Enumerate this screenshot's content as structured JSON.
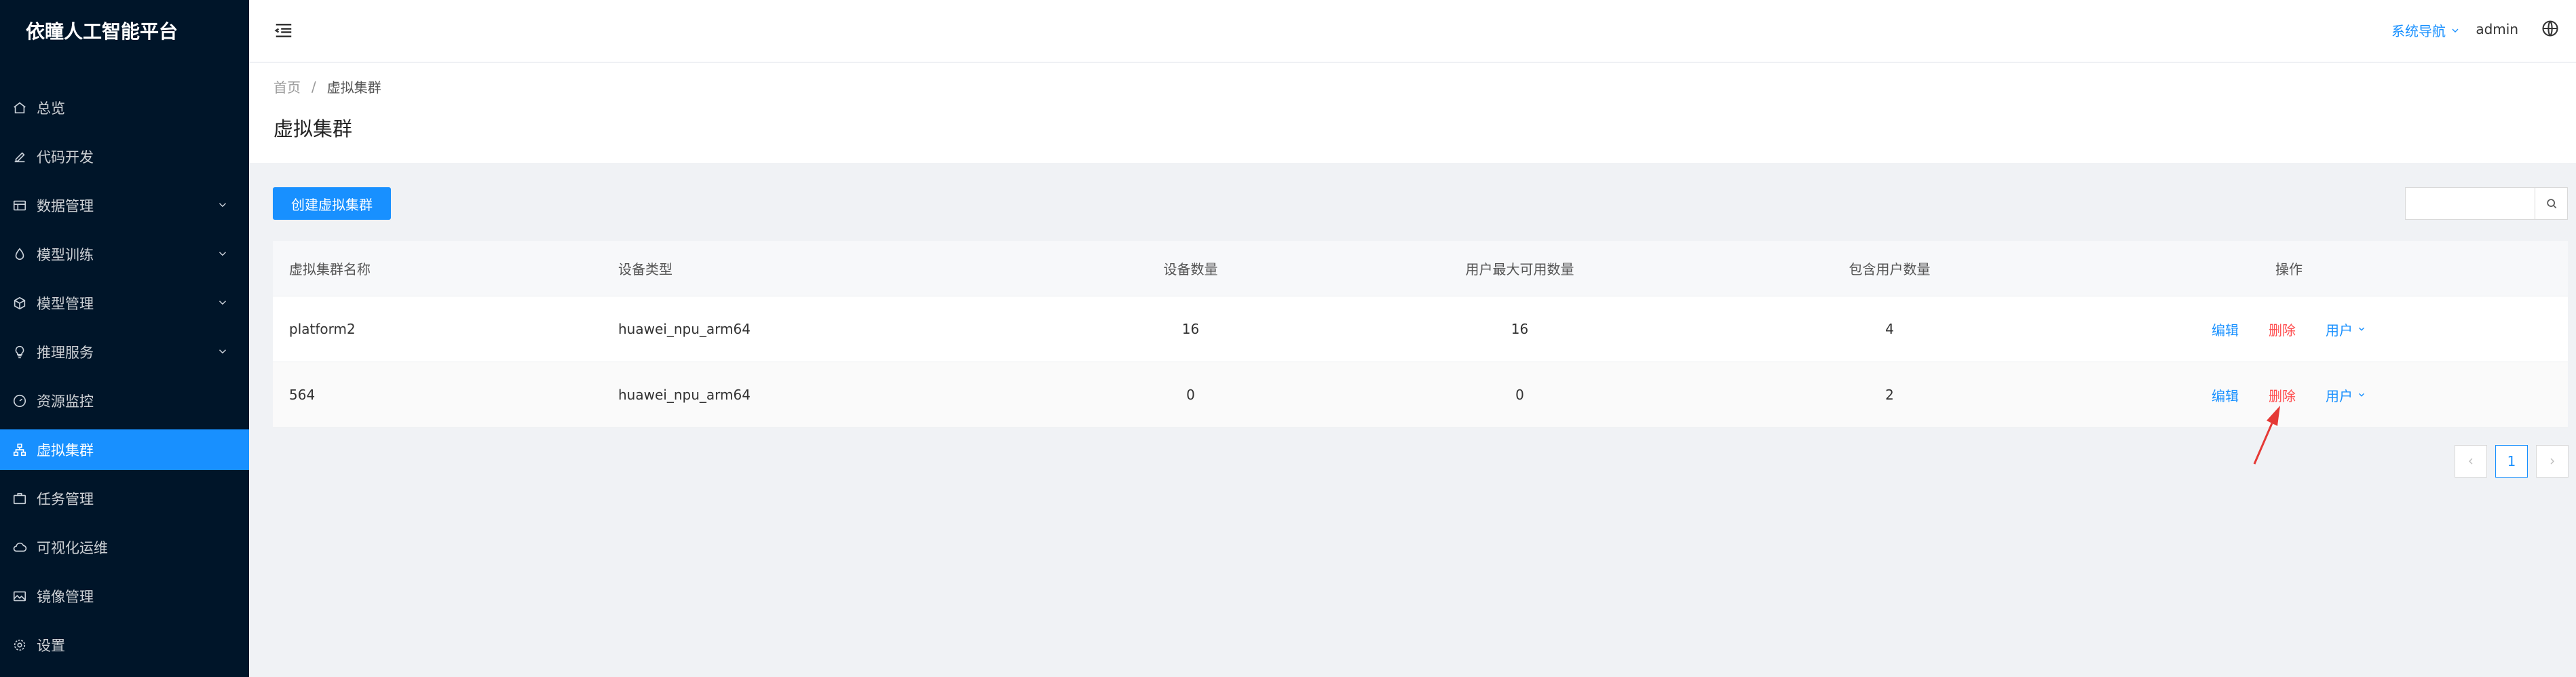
{
  "sidebar": {
    "brand": "依瞳人工智能平台",
    "items": [
      {
        "label": "总览",
        "icon": "home-icon"
      },
      {
        "label": "代码开发",
        "icon": "edit-icon"
      },
      {
        "label": "数据管理",
        "icon": "database-icon",
        "expandable": true
      },
      {
        "label": "模型训练",
        "icon": "droplet-icon",
        "expandable": true
      },
      {
        "label": "模型管理",
        "icon": "cube-icon",
        "expandable": true
      },
      {
        "label": "推理服务",
        "icon": "bulb-icon",
        "expandable": true
      },
      {
        "label": "资源监控",
        "icon": "gauge-icon"
      },
      {
        "label": "虚拟集群",
        "icon": "cluster-icon",
        "active": true
      },
      {
        "label": "任务管理",
        "icon": "briefcase-icon"
      },
      {
        "label": "可视化运维",
        "icon": "cloud-icon"
      },
      {
        "label": "镜像管理",
        "icon": "image-icon"
      },
      {
        "label": "设置",
        "icon": "gear-icon"
      }
    ]
  },
  "header": {
    "system_nav": "系统导航",
    "user": "admin"
  },
  "breadcrumb": {
    "home": "首页",
    "separator": "/",
    "current": "虚拟集群"
  },
  "page_title": "虚拟集群",
  "toolbar": {
    "create_label": "创建虚拟集群",
    "search_value": "",
    "search_placeholder": ""
  },
  "table": {
    "columns": [
      "虚拟集群名称",
      "设备类型",
      "设备数量",
      "用户最大可用数量",
      "包含用户数量",
      "操作"
    ],
    "rows": [
      {
        "name": "platform2",
        "device_type": "huawei_npu_arm64",
        "device_count": "16",
        "max_users": "16",
        "user_count": "4"
      },
      {
        "name": "564",
        "device_type": "huawei_npu_arm64",
        "device_count": "0",
        "max_users": "0",
        "user_count": "2"
      }
    ],
    "actions": {
      "edit": "编辑",
      "delete": "删除",
      "users": "用户"
    }
  },
  "pagination": {
    "current": "1"
  },
  "colors": {
    "sidebar_bg": "#001529",
    "accent": "#1890ff",
    "danger": "#ff4d4f",
    "annotation": "#e53935"
  }
}
